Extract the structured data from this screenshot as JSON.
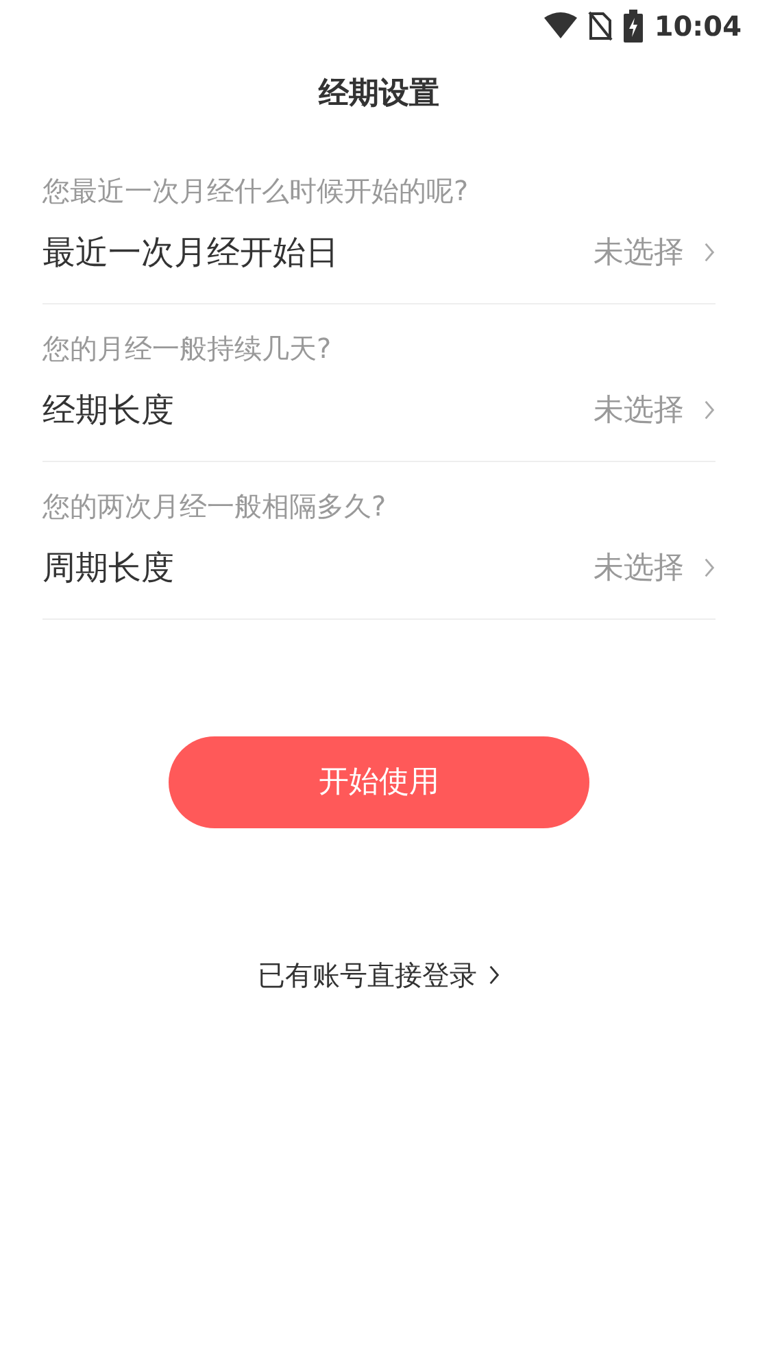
{
  "status_bar": {
    "time": "10:04"
  },
  "title": "经期设置",
  "settings": [
    {
      "question": "您最近一次月经什么时候开始的呢?",
      "label": "最近一次月经开始日",
      "value": "未选择"
    },
    {
      "question": "您的月经一般持续几天?",
      "label": "经期长度",
      "value": "未选择"
    },
    {
      "question": "您的两次月经一般相隔多久?",
      "label": "周期长度",
      "value": "未选择"
    }
  ],
  "start_button": "开始使用",
  "login_link": "已有账号直接登录"
}
